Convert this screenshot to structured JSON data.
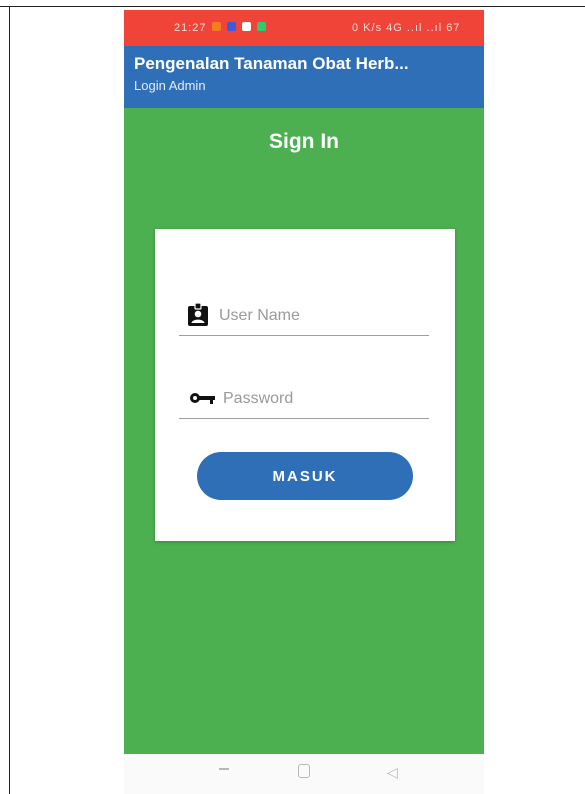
{
  "status_bar": {
    "time": "21:27",
    "right_text": "0 K/s 4G ..ıl ..ıl 67",
    "icon_colors": [
      "#f57c1f",
      "#3b5bdb",
      "#ffffff",
      "#2ecc71"
    ]
  },
  "app_bar": {
    "title": "Pengenalan Tanaman Obat Herb...",
    "subtitle": "Login Admin"
  },
  "page": {
    "heading": "Sign In"
  },
  "form": {
    "username": {
      "placeholder": "User Name",
      "value": "",
      "icon": "contact-badge-icon"
    },
    "password": {
      "placeholder": "Password",
      "value": "",
      "icon": "key-icon"
    },
    "submit_label": "MASUK"
  },
  "nav_bar": {
    "icons": [
      "recent-apps-icon",
      "home-icon",
      "back-icon"
    ]
  },
  "colors": {
    "status_bar": "#f04438",
    "app_bar": "#2f6fb8",
    "background": "#4caf50",
    "button": "#2f6fb8"
  }
}
